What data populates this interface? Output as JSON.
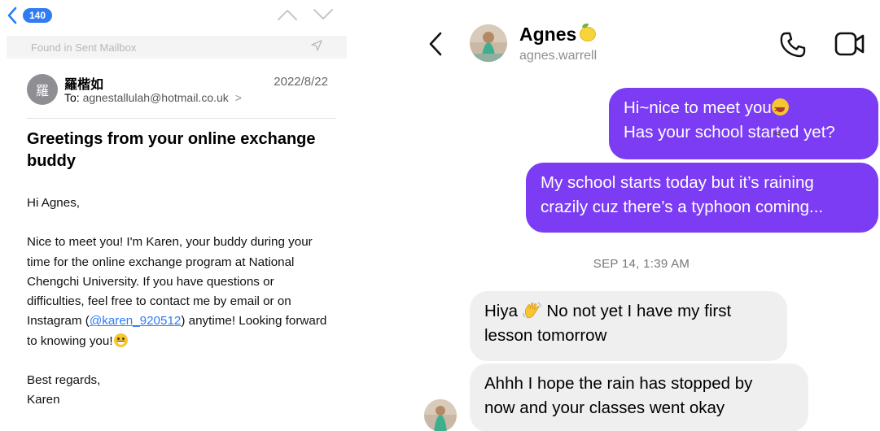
{
  "mail": {
    "unread_count": "140",
    "found_in": "Found in Sent Mailbox",
    "sender": {
      "avatar_letter": "羅",
      "name": "羅楷如",
      "to_label": "To:",
      "to_address": "agnestallulah@hotmail.co.uk",
      "date": "2022/8/22"
    },
    "subject": "Greetings from your online exchange buddy",
    "greeting": "Hi Agnes,",
    "body_before_link": "Nice to meet you! I'm Karen, your buddy during your time for the online exchange program at National Chengchi University. If you have questions or difficulties, feel free to contact me by email or on Instagram (",
    "link_text": "@karen_920512",
    "body_after_link": ") anytime! Looking forward to knowing you!",
    "signoff": "Best regards,",
    "signature": "Karen"
  },
  "dm": {
    "contact_name": "Agnes",
    "handle": "agnes.warrell",
    "timestamp": "SEP 14, 1:39 AM",
    "messages": [
      {
        "direction": "out",
        "line1": "Hi~nice to meet you",
        "line2": "Has your school started yet?"
      },
      {
        "direction": "out",
        "line1": "My school starts today but it’s raining",
        "line2": "crazily cuz there’s a typhoon coming..."
      },
      {
        "direction": "in",
        "line1a": "Hiya",
        "line1b": "No not yet I have my first",
        "line2": "lesson tomorrow"
      },
      {
        "direction": "in",
        "line1": "Ahhh I hope the rain has stopped by",
        "line2": "now and your classes went okay"
      }
    ]
  },
  "colors": {
    "accent_blue": "#2f7cf6",
    "bubble_purple": "#7b3cf4",
    "bubble_gray": "#efefef"
  },
  "icons": [
    "back-chevron-icon",
    "up-arrow-icon",
    "down-arrow-icon",
    "send-icon",
    "chevron-right-icon",
    "phone-icon",
    "video-camera-icon",
    "lemon-emoji",
    "laughing-emoji",
    "waving-hand-emoji",
    "grinning-emoji"
  ]
}
